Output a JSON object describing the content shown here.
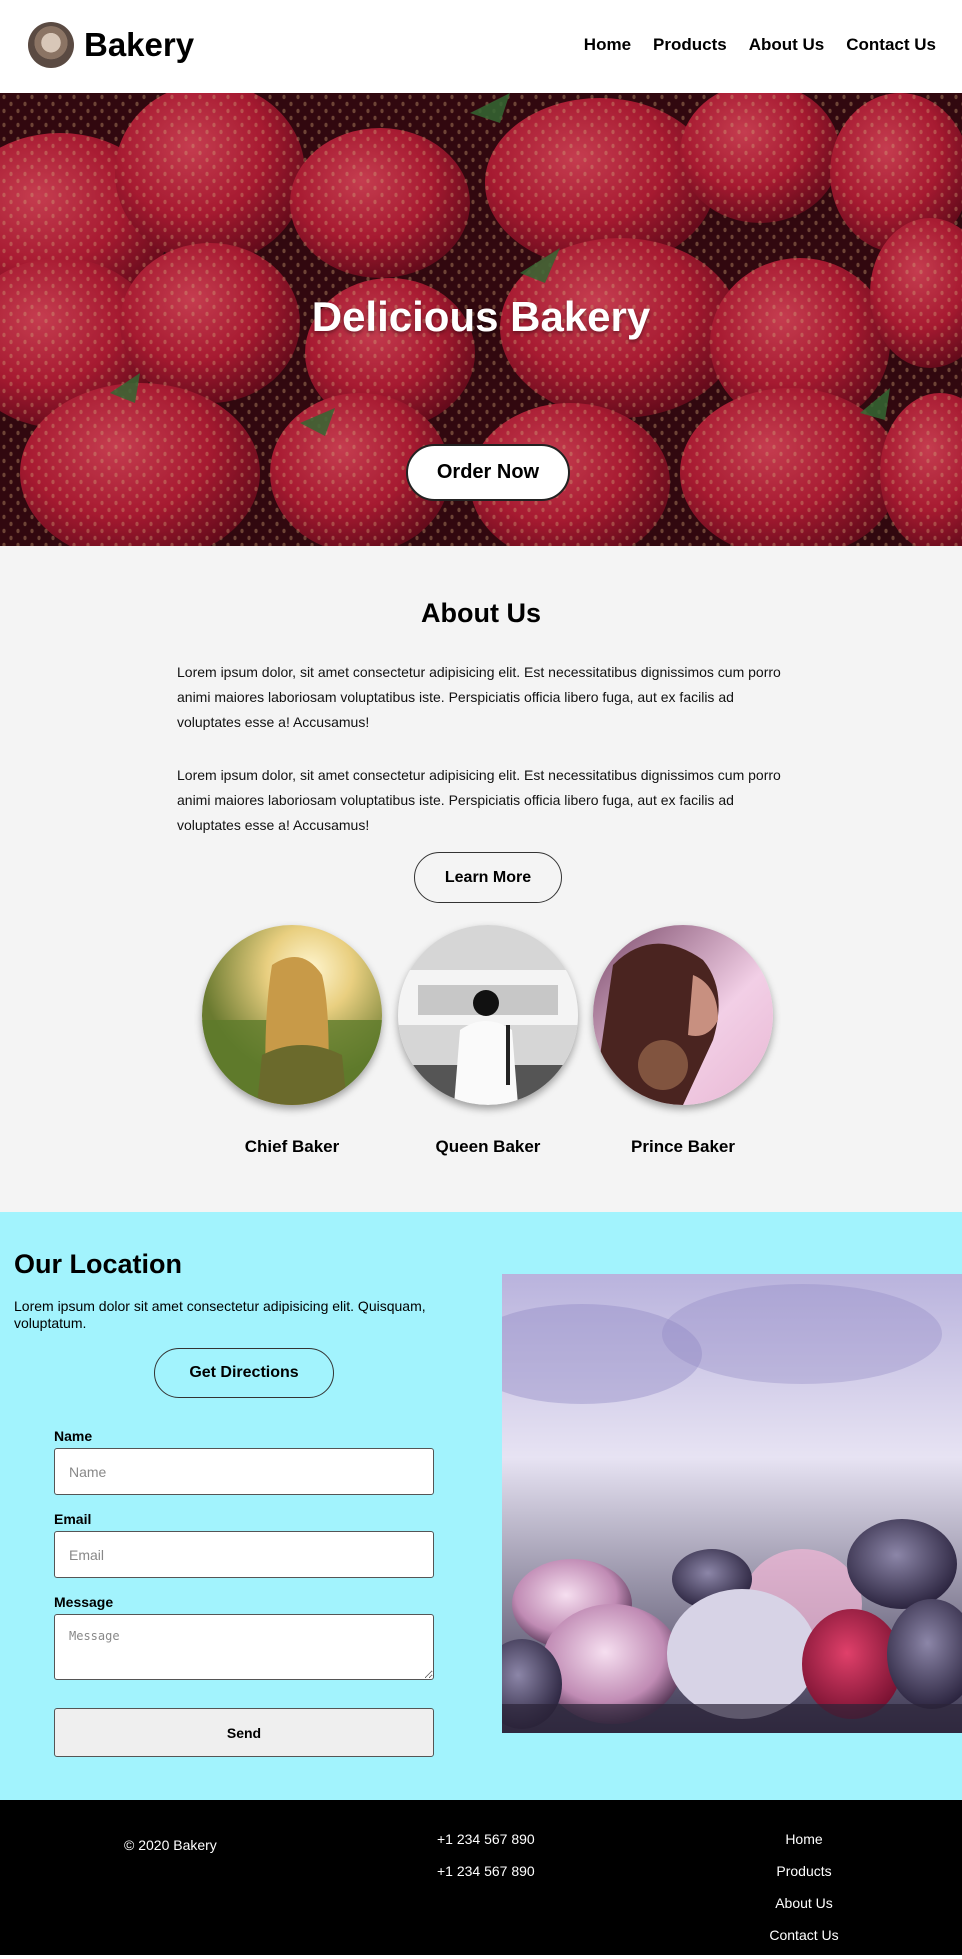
{
  "header": {
    "brand": "Bakery",
    "nav": [
      "Home",
      "Products",
      "About Us",
      "Contact Us"
    ]
  },
  "hero": {
    "title": "Delicious Bakery",
    "button": "Order Now"
  },
  "about": {
    "title": "About Us",
    "paragraphs": [
      "Lorem ipsum dolor, sit amet consectetur adipisicing elit. Est necessitatibus dignissimos cum porro animi maiores laboriosam voluptatibus iste. Perspiciatis officia libero fuga, aut ex facilis ad voluptates esse a! Accusamus!",
      "Lorem ipsum dolor, sit amet consectetur adipisicing elit. Est necessitatibus dignissimos cum porro animi maiores laboriosam voluptatibus iste. Perspiciatis officia libero fuga, aut ex facilis ad voluptates esse a! Accusamus!"
    ],
    "button": "Learn More",
    "team": [
      "Chief Baker",
      "Queen Baker",
      "Prince Baker"
    ]
  },
  "location": {
    "title": "Our Location",
    "text": "Lorem ipsum dolor sit amet consectetur adipisicing elit. Quisquam, voluptatum.",
    "button": "Get Directions",
    "form": {
      "name_label": "Name",
      "name_placeholder": "Name",
      "email_label": "Email",
      "email_placeholder": "Email",
      "message_label": "Message",
      "message_placeholder": "Message",
      "send": "Send"
    }
  },
  "footer": {
    "copyright": "© 2020 Bakery",
    "phones": [
      "+1 234 567 890",
      "+1 234 567 890"
    ],
    "links": [
      "Home",
      "Products",
      "About Us",
      "Contact Us"
    ]
  },
  "colors": {
    "about_bg": "#f4f4f4",
    "location_bg": "#a2f3fd",
    "footer_bg": "#000000"
  }
}
